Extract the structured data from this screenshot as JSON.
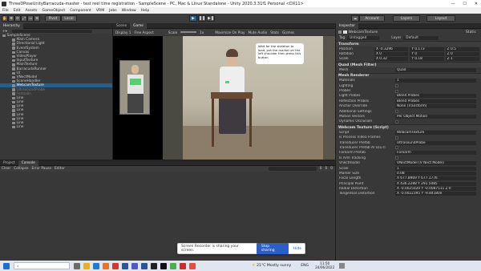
{
  "window": {
    "title": "ThreeDPoseUnityBarracuda-master - test reel time registration - SampleScene - PC, Mac & Linux Standalone - Unity 2020.3.31f1 Personal <DX11>"
  },
  "menu": [
    "File",
    "Edit",
    "Assets",
    "GameObject",
    "Component",
    "VRM",
    "Jobs",
    "Window",
    "Help"
  ],
  "toolbar": {
    "pivot": "Pivot",
    "local": "Local",
    "account": "Account",
    "layers": "Layers",
    "layout": "Layout",
    "play": "▶",
    "pause": "❚❚",
    "step": "▶❚"
  },
  "hierarchy": {
    "tab": "Hierarchy",
    "rows": [
      {
        "label": "SampleScene",
        "indent": 0,
        "sel": false,
        "dis": false
      },
      {
        "label": "Main Camera",
        "indent": 2,
        "sel": false,
        "dis": false
      },
      {
        "label": "Directional Light",
        "indent": 2,
        "sel": false,
        "dis": false
      },
      {
        "label": "EventSystem",
        "indent": 2,
        "sel": false,
        "dis": false
      },
      {
        "label": "Canvas",
        "indent": 2,
        "sel": false,
        "dis": false
      },
      {
        "label": "VideoPlayer",
        "indent": 2,
        "sel": false,
        "dis": false
      },
      {
        "label": "InputTexture",
        "indent": 2,
        "sel": false,
        "dis": false
      },
      {
        "label": "MainTexture",
        "indent": 2,
        "sel": false,
        "dis": false
      },
      {
        "label": "BarracudaRunner",
        "indent": 2,
        "sel": false,
        "dis": false
      },
      {
        "label": "UI",
        "indent": 2,
        "sel": false,
        "dis": false
      },
      {
        "label": "VNectModel",
        "indent": 2,
        "sel": false,
        "dis": false
      },
      {
        "label": "SceneHandler",
        "indent": 2,
        "sel": false,
        "dis": false
      },
      {
        "label": "WebcamTexture",
        "indent": 2,
        "sel": true,
        "dis": false
      },
      {
        "label": "UltrasoundProbe",
        "indent": 2,
        "sel": false,
        "dis": true
      },
      {
        "label": "Fortsalin",
        "indent": 2,
        "sel": false,
        "dis": true
      },
      {
        "label": "Line",
        "indent": 2,
        "sel": false,
        "dis": false
      },
      {
        "label": "Line",
        "indent": 2,
        "sel": false,
        "dis": false
      },
      {
        "label": "Line",
        "indent": 2,
        "sel": false,
        "dis": false
      },
      {
        "label": "Line",
        "indent": 2,
        "sel": false,
        "dis": false
      },
      {
        "label": "Line",
        "indent": 2,
        "sel": false,
        "dis": false
      },
      {
        "label": "Line",
        "indent": 2,
        "sel": false,
        "dis": false
      },
      {
        "label": "Line",
        "indent": 2,
        "sel": false,
        "dis": false
      },
      {
        "label": "Line",
        "indent": 2,
        "sel": false,
        "dis": false
      }
    ]
  },
  "game": {
    "tabs": [
      "Scene",
      "Game"
    ],
    "display": "Display 1",
    "aspect": "Free Aspect",
    "scale_label": "Scale",
    "scale_val": "1x",
    "opts": [
      "Maximize On Play",
      "Mute Audio",
      "Stats",
      "Gizmos"
    ],
    "bubble": "Wait for the skeleton to load, put the marker on the left shoulder then press this button"
  },
  "console": {
    "tabs": [
      "Project",
      "Console"
    ],
    "buttons": [
      "Clear",
      "Collapse",
      "Error Pause",
      "Editor"
    ],
    "counts": [
      "0",
      "0",
      "0"
    ]
  },
  "inspector": {
    "tab": "Inspector",
    "object": "WebcamTexture",
    "static": "Static",
    "tag_label": "Tag",
    "tag": "Untagged",
    "layer_label": "Layer",
    "layer": "Default",
    "transform": {
      "title": "Transform",
      "rows": [
        {
          "k": "Position",
          "x": "X -0.3296",
          "y": "Y 0.173",
          "z": "Z 0.5"
        },
        {
          "k": "Rotation",
          "x": "X 0",
          "y": "Y 0",
          "z": "Z 0"
        },
        {
          "k": "Scale",
          "x": "X 0.32",
          "y": "Y 0.18",
          "z": "Z 1"
        }
      ]
    },
    "mesh_filter": {
      "title": "Quad (Mesh Filter)",
      "mesh_label": "Mesh",
      "mesh": "Quad"
    },
    "renderer": {
      "title": "Mesh Renderer",
      "rows": [
        {
          "k": "Materials",
          "v": "1"
        },
        {
          "k": "Lighting",
          "v": ""
        },
        {
          "k": "Probes",
          "v": ""
        },
        {
          "k": "Light Probes",
          "v": "Blend Probes"
        },
        {
          "k": "Reflection Probes",
          "v": "Blend Probes"
        },
        {
          "k": "Anchor Override",
          "v": "None (Transform)"
        },
        {
          "k": "Additional Settings",
          "v": ""
        },
        {
          "k": "Motion Vectors",
          "v": "Per Object Motion"
        },
        {
          "k": "Dynamic Occlusion",
          "v": ""
        }
      ]
    },
    "script": {
      "title": "Webcam Texture (Script)",
      "rows": [
        {
          "k": "Script",
          "v": "WebcamTexture"
        },
        {
          "k": "Is Process Video Frames",
          "v": ""
        },
        {
          "k": "Transducer Prefab",
          "v": "UltrasoundProbe"
        },
        {
          "k": "Transducer Prefab Al Ucu Il",
          "v": ""
        },
        {
          "k": "Forearm Prefab",
          "v": "Forearm"
        },
        {
          "k": "Is Arm Tracking",
          "v": ""
        },
        {
          "k": "Vnectmodel",
          "v": "VNectModel (V Nect Model)"
        },
        {
          "k": "Scale",
          "v": "1"
        },
        {
          "k": "Marker Size",
          "v": "0.08"
        },
        {
          "k": "Focal Length",
          "v": "X 677.8969    Y 677.1776"
        },
        {
          "k": "Principal Point",
          "v": "X 436.2288    Y 291.5085"
        },
        {
          "k": "Radial Distortion",
          "v": "X -0.0025020    Y -0.0087511    Z 0"
        },
        {
          "k": "Tangential Distortion",
          "v": "X -0.0022395    Y -9.84180e"
        }
      ]
    }
  },
  "recorder": {
    "msg": "Screen Recorder is sharing your screen.",
    "stop": "Stop sharing",
    "hide": "Hide"
  },
  "taskbar": {
    "weather": "21°C  Mostly sunny",
    "lang": "ENG",
    "time": "11:50",
    "date": "24/06/2022"
  },
  "colors": {
    "accent": "#2c5d87",
    "panel": "#383838",
    "bg": "#1e1e1e"
  }
}
